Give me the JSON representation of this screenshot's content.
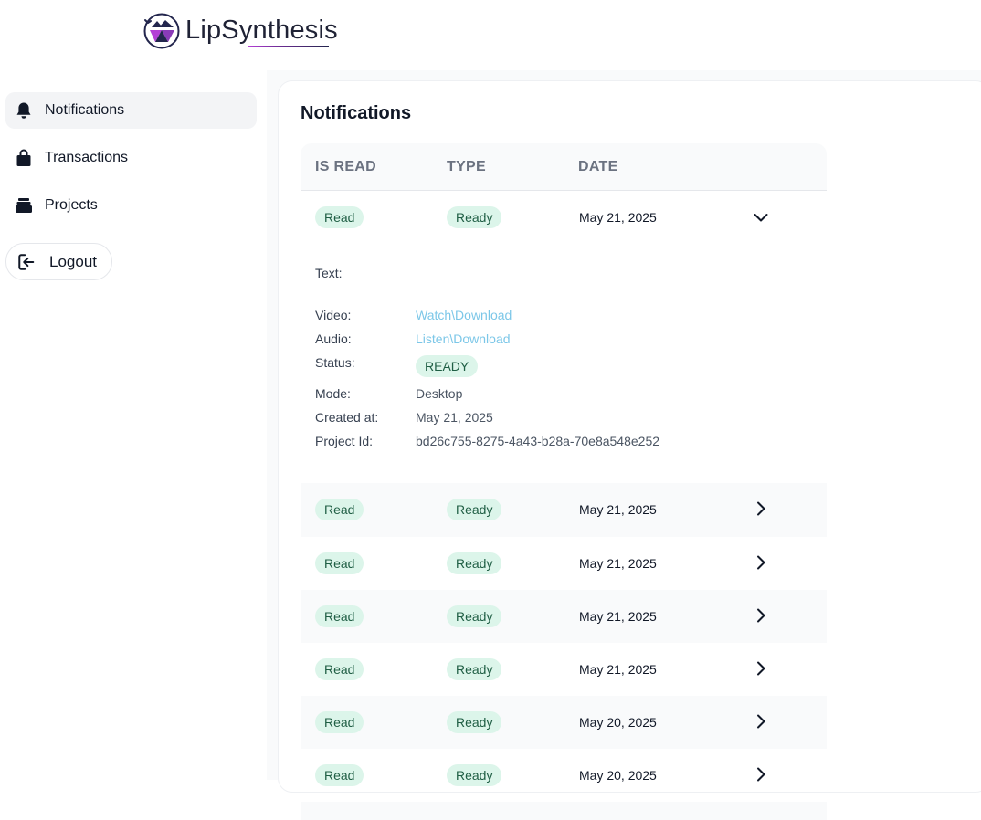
{
  "brand": {
    "name": "LipSynthesis"
  },
  "sidebar": {
    "items": [
      {
        "label": "Notifications",
        "icon": "bell-icon",
        "active": true
      },
      {
        "label": "Transactions",
        "icon": "shopping-bag-icon",
        "active": false
      },
      {
        "label": "Projects",
        "icon": "stack-icon",
        "active": false
      }
    ],
    "logout_label": "Logout"
  },
  "main": {
    "title": "Notifications",
    "table": {
      "columns": [
        "IS READ",
        "TYPE",
        "DATE"
      ],
      "rows": [
        {
          "is_read": "Read",
          "type": "Ready",
          "date": "May 21, 2025",
          "expanded": true
        },
        {
          "is_read": "Read",
          "type": "Ready",
          "date": "May 21, 2025",
          "expanded": false
        },
        {
          "is_read": "Read",
          "type": "Ready",
          "date": "May 21, 2025",
          "expanded": false
        },
        {
          "is_read": "Read",
          "type": "Ready",
          "date": "May 21, 2025",
          "expanded": false
        },
        {
          "is_read": "Read",
          "type": "Ready",
          "date": "May 21, 2025",
          "expanded": false
        },
        {
          "is_read": "Read",
          "type": "Ready",
          "date": "May 20, 2025",
          "expanded": false
        },
        {
          "is_read": "Read",
          "type": "Ready",
          "date": "May 20, 2025",
          "expanded": false
        }
      ],
      "details": {
        "text_label": "Text:",
        "text_value": "",
        "video_label": "Video:",
        "video_value": "Watch\\Download",
        "audio_label": "Audio:",
        "audio_value": "Listen\\Download",
        "status_label": "Status:",
        "status_value": "READY",
        "mode_label": "Mode:",
        "mode_value": "Desktop",
        "created_label": "Created at:",
        "created_value": "May 21, 2025",
        "project_label": "Project Id:",
        "project_value": "bd26c755-8275-4a43-b28a-70e8a548e252"
      }
    }
  },
  "colors": {
    "badge_bg": "#dcf5ea",
    "badge_text": "#1f5e44",
    "link": "#7cc7e8",
    "active_nav_bg": "#f3f4f6"
  }
}
